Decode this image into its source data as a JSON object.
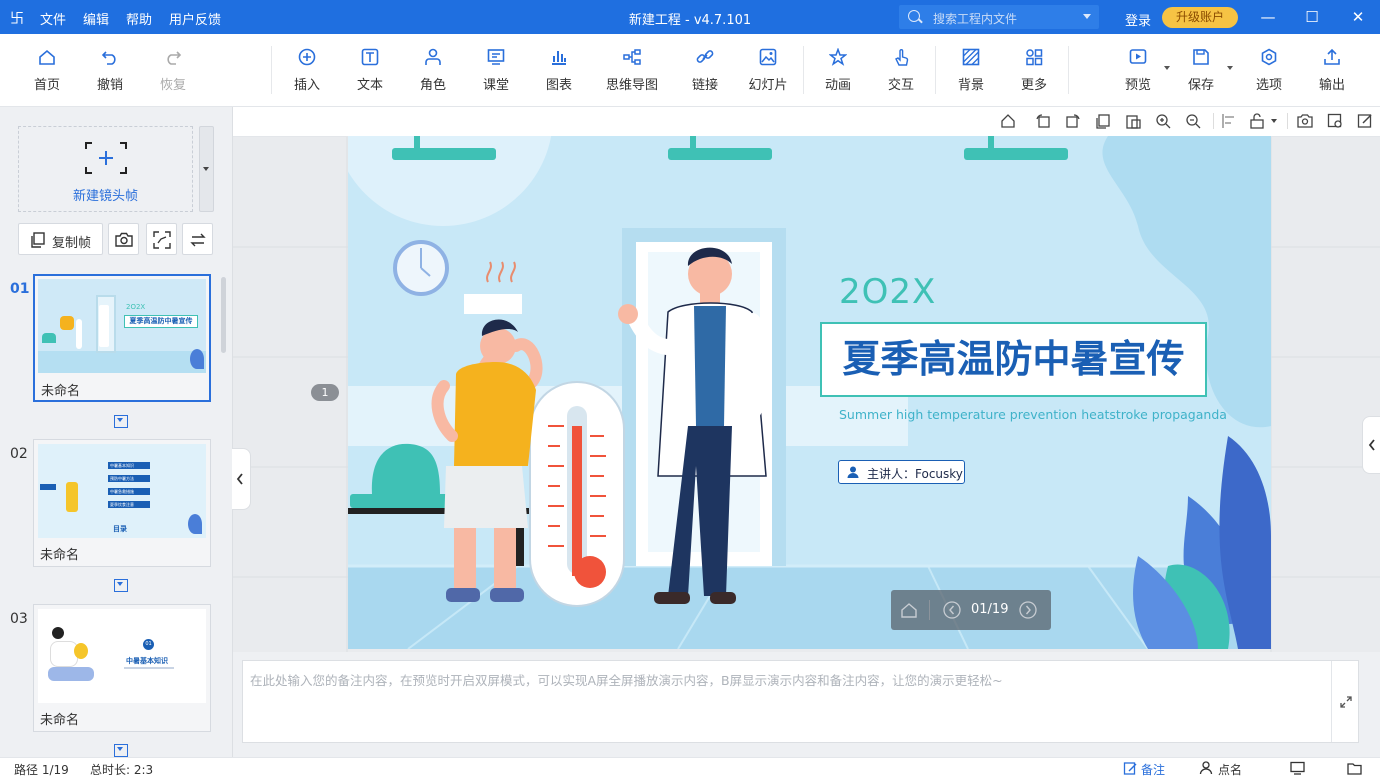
{
  "titlebar": {
    "logo": "卐",
    "menu": [
      "文件",
      "编辑",
      "帮助",
      "用户反馈"
    ],
    "title": "新建工程 - v4.7.101",
    "search_placeholder": "搜索工程内文件",
    "login": "登录",
    "upgrade": "升级账户",
    "window_controls": [
      "—",
      "☐",
      "✕"
    ]
  },
  "toolbar": {
    "home": "首页",
    "undo": "撤销",
    "redo": "恢复",
    "insert": "插入",
    "text": "文本",
    "role": "角色",
    "classroom": "课堂",
    "chart": "图表",
    "mindmap": "思维导图",
    "link": "链接",
    "slide": "幻灯片",
    "animation": "动画",
    "interact": "交互",
    "background": "背景",
    "more": "更多",
    "preview": "预览",
    "save": "保存",
    "options": "选项",
    "export": "输出"
  },
  "left_panel": {
    "new_frame": "新建镜头帧",
    "copy_frame": "复制帧",
    "slides": [
      {
        "num": "01",
        "name": "未命名",
        "active": true
      },
      {
        "num": "02",
        "name": "未命名",
        "active": false
      },
      {
        "num": "03",
        "name": "未命名",
        "active": false
      }
    ],
    "thumb1": {
      "year": "2O2X",
      "title": "夏季高温防中暑宣传"
    },
    "thumb2": {
      "items": [
        "中暑基本知识",
        "预防中暑方法",
        "中暑急救措施",
        "夏季饮食注意"
      ],
      "footer": "目录"
    },
    "thumb3": {
      "num": "01",
      "title": "中暑基本知识"
    }
  },
  "canvas": {
    "frame_marker": "1",
    "slide": {
      "year": "2O2X",
      "title": "夏季高温防中暑宣传",
      "subtitle": "Summer high temperature prevention heatstroke propaganda",
      "presenter": "主讲人：Focusky",
      "nav_counter": "01/19"
    }
  },
  "notes": {
    "placeholder": "在此处输入您的备注内容，在预览时开启双屏模式，可以实现A屏全屏播放演示内容，B屏显示演示内容和备注内容，让您的演示更轻松~"
  },
  "statusbar": {
    "path": "路径 1/19",
    "duration": "总时长: 2:3",
    "notes": "备注",
    "rollcall": "点名"
  },
  "colors": {
    "accent": "#1f6fe0",
    "upgrade": "#f6c344",
    "slide_bg": "#c8e8f7",
    "slide_title": "#1a5fb4",
    "teal": "#3fc1b5"
  }
}
